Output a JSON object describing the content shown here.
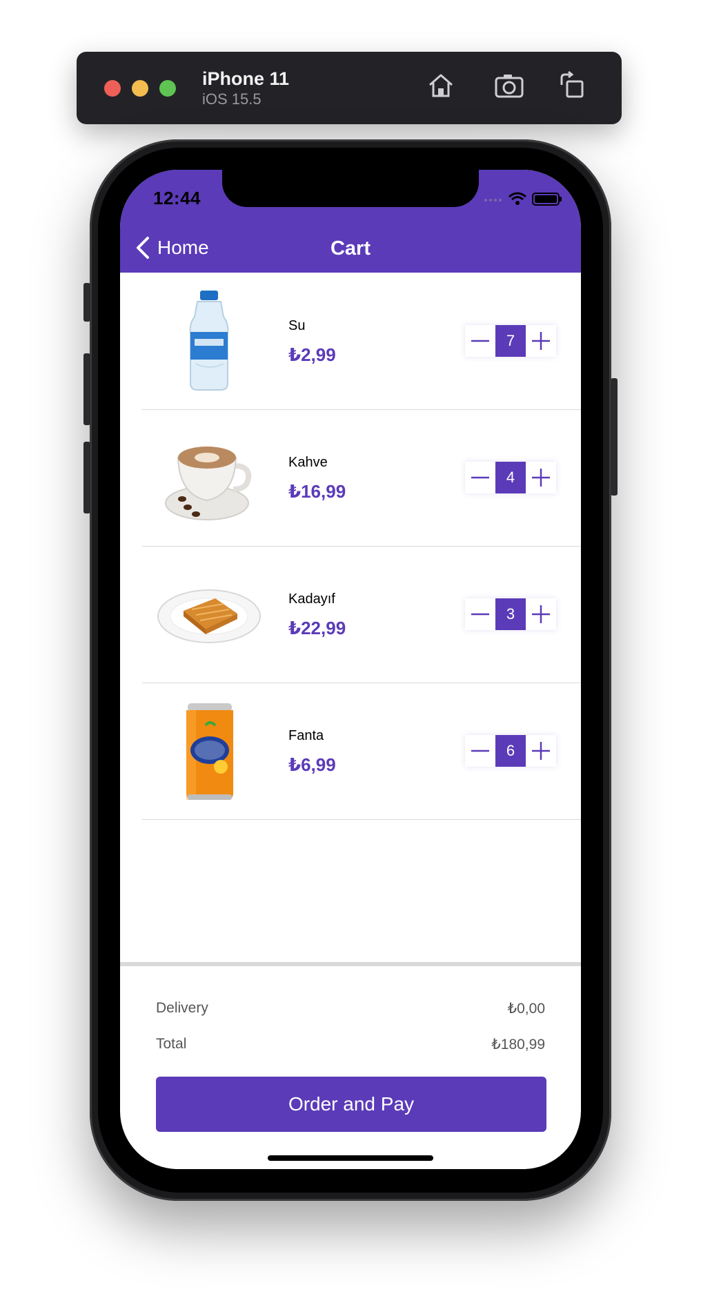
{
  "simulator": {
    "device_name": "iPhone 11",
    "os_version": "iOS 15.5",
    "icons": [
      "home-icon",
      "screenshot-icon",
      "rotate-icon"
    ]
  },
  "status_bar": {
    "time": "12:44"
  },
  "nav": {
    "back_label": "Home",
    "title": "Cart"
  },
  "cart": {
    "items": [
      {
        "name": "Su",
        "price": "₺2,99",
        "quantity": "7",
        "image": "water-bottle"
      },
      {
        "name": "Kahve",
        "price": "₺16,99",
        "quantity": "4",
        "image": "coffee-cup"
      },
      {
        "name": "Kadayıf",
        "price": "₺22,99",
        "quantity": "3",
        "image": "kadayif-plate"
      },
      {
        "name": "Fanta",
        "price": "₺6,99",
        "quantity": "6",
        "image": "fanta-can"
      }
    ]
  },
  "summary": {
    "delivery_label": "Delivery",
    "delivery_value": "₺0,00",
    "total_label": "Total",
    "total_value": "₺180,99"
  },
  "actions": {
    "pay_label": "Order and Pay"
  },
  "colors": {
    "accent": "#5b3bb8",
    "sim_bar": "#232327"
  }
}
